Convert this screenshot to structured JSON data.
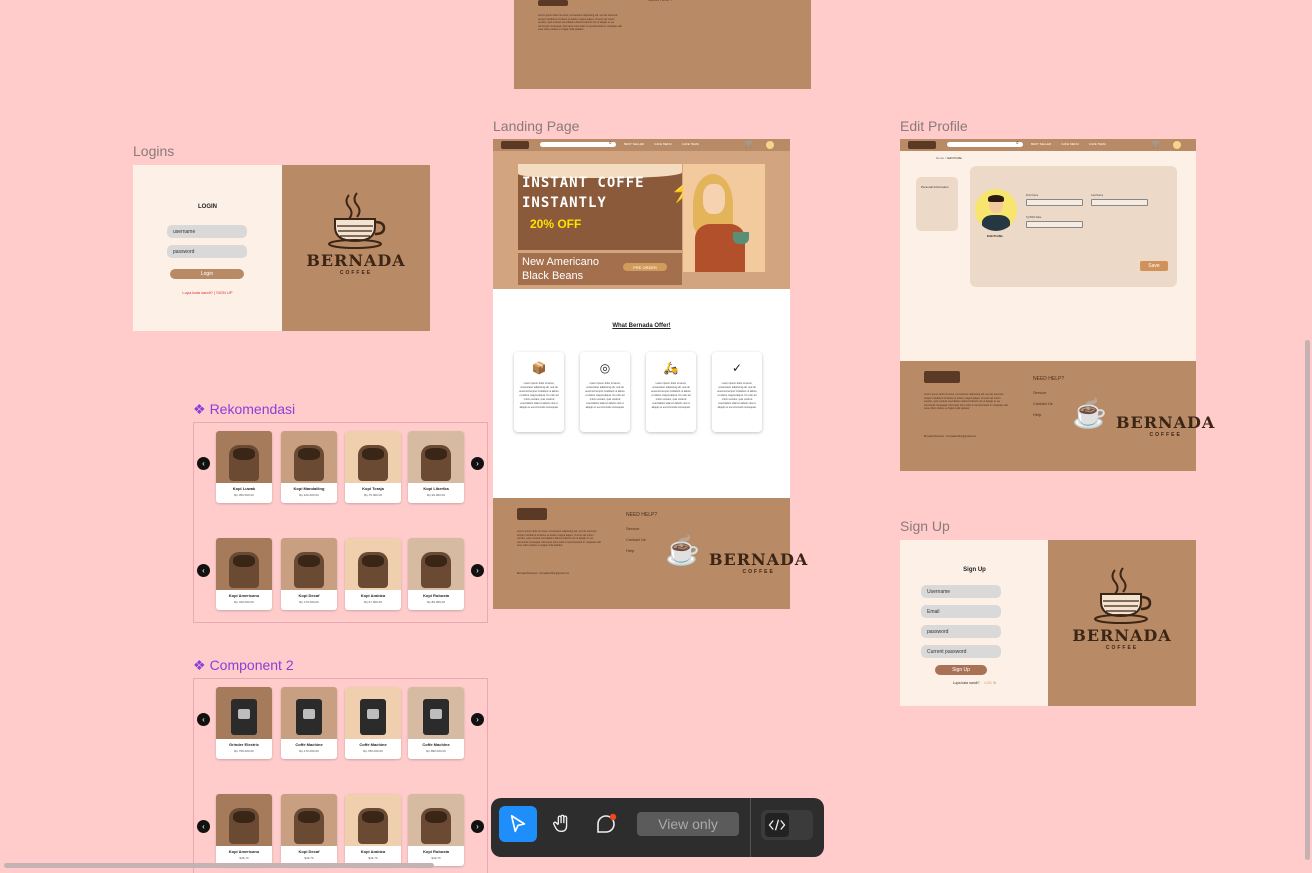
{
  "frames": {
    "logins": "Logins",
    "landing": "Landing Page",
    "edit_profile": "Edit Profile",
    "signup": "Sign Up"
  },
  "components": {
    "rekomendasi": "Rekomendasi",
    "component2": "Component 2",
    "diamond": "❖"
  },
  "login": {
    "title": "LOGIN",
    "username_placeholder": "username",
    "password_placeholder": "password",
    "button": "Login",
    "forgot": "Lupa kata sandi?",
    "divider": "|",
    "signup_link": "SIGN UP"
  },
  "brand": {
    "name": "BERNADA",
    "sub": "COFFEE"
  },
  "landing": {
    "nav_items": [
      "BEST SELLER",
      "CAFE MENU",
      "CAFE TEMA"
    ],
    "hero_line1": "INSTANT COFFE",
    "hero_line2": "INSTANTLY",
    "hero_discount": "20% OFF",
    "hero_product1": "New Americano",
    "hero_product2": "Black Beans",
    "preorder": "PRE ORDER",
    "offer_title": "What Bernada Offer!",
    "offer_text": "Lorem ipsum dolor sit amet, consectetur adipiscing elit, sed do eiusmod tempor incididunt ut labore et dolore magna aliqua. Ut enim ad minim veniam, quis nostrud exercitation ullamco laboris nisi ut aliquip ex ea commodo consequat.",
    "need_help": "NEED HELP?",
    "help_links": [
      "Service",
      "Contact Us",
      "Help"
    ],
    "footer_text": "Lorem ipsum dolor sit amet, consectetur adipiscing elit, sed do eiusmod tempor incididunt ut labore et dolore magna aliqua. Ut enim ad minim veniam, quis nostrud exercitation ullamco laboris nisi ut aliquip ex ea commodo consequat. Duis aute irure dolor in reprehenderit in voluptate velit esse cillum dolore eu fugiat nulla pariatur.",
    "footer_contact": "Bernada Business : bernadacoffee@gmail.com"
  },
  "rekomendasi": {
    "row1": [
      {
        "name": "Kopi Luwak",
        "price": "Rp.350.000,00"
      },
      {
        "name": "Kopi Mandailing",
        "price": "Rp.100.000,00"
      },
      {
        "name": "Kopi Toraja",
        "price": "Rp.75.000,00"
      },
      {
        "name": "Kopi Liberika",
        "price": "Rp.99.000,00"
      }
    ],
    "row2": [
      {
        "name": "Kopi Americano",
        "price": "Rp.449.000,00"
      },
      {
        "name": "Kopi Decaf",
        "price": "Rp.170.000,00"
      },
      {
        "name": "Kopi Arabica",
        "price": "Rp.67.000,00"
      },
      {
        "name": "Kopi Robusta",
        "price": "Rp.80.000,00"
      }
    ]
  },
  "component2": {
    "row1": [
      {
        "name": "Grinder Elextric",
        "price": "Rp.790.000,00"
      },
      {
        "name": "Coffe Machine",
        "price": "Rp.170.000,00"
      },
      {
        "name": "Coffe Machine",
        "price": "Rp.780.000,00"
      },
      {
        "name": "Coffe Machine",
        "price": "Rp.890.000,00"
      }
    ],
    "row2": [
      {
        "name": "Kopi Americano",
        "price": "$45,70"
      },
      {
        "name": "Kopi Decaf",
        "price": "$43,70"
      },
      {
        "name": "Kopi Arabica",
        "price": "$44,70"
      },
      {
        "name": "Kopi Robusta",
        "price": "$43,70"
      }
    ]
  },
  "edit_profile": {
    "breadcrumb_home": "Home >",
    "breadcrumb_current": "Edit Profile",
    "sidebar": "Personal Information",
    "avatar_caption": "Edit Profile",
    "first_name": "First Name",
    "last_name": "Last Name",
    "birth_date": "Tgl Birth Date",
    "save": "Save"
  },
  "signup": {
    "title": "Sign Up",
    "username": "Username",
    "email": "Email",
    "password": "password",
    "confirm": "Current password",
    "button": "Sign Up",
    "login_prompt": "Lupa kata sandi?",
    "login_link": "LOG IN"
  },
  "toolbar": {
    "view_only": "View only"
  },
  "colors": {
    "canvas": "#ffcccb",
    "brown": "#b98a66",
    "cream": "#fdf0e6",
    "accent": "#1e8ffa",
    "component": "#8b3fd6"
  }
}
